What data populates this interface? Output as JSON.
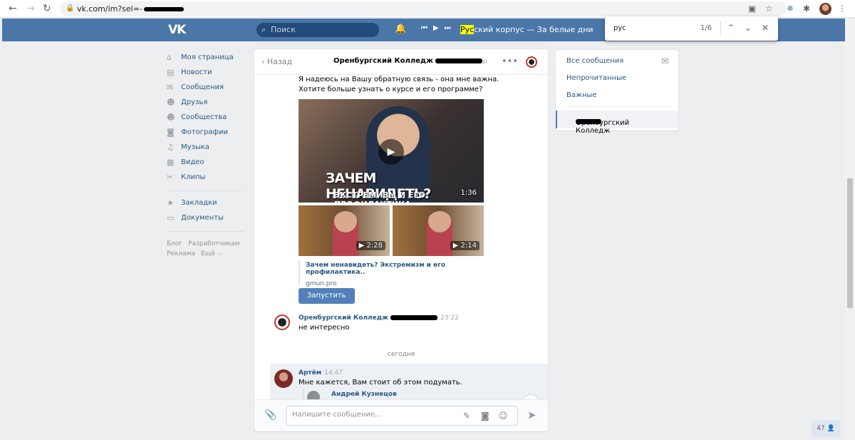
{
  "browser": {
    "url": "vk.com/im?sel=-",
    "find": {
      "query": "рус",
      "count": "1/6"
    }
  },
  "vk": {
    "search_placeholder": "Поиск",
    "now_playing": {
      "highlight": "Рус",
      "rest": "ский корпус — За белые дни"
    }
  },
  "left_menu": {
    "items": [
      {
        "label": "Моя страница",
        "icon": "home-icon"
      },
      {
        "label": "Новости",
        "icon": "news-icon"
      },
      {
        "label": "Сообщения",
        "icon": "messages-icon"
      },
      {
        "label": "Друзья",
        "icon": "friends-icon"
      },
      {
        "label": "Сообщества",
        "icon": "communities-icon"
      },
      {
        "label": "Фотографии",
        "icon": "photo-icon"
      },
      {
        "label": "Музыка",
        "icon": "music-icon"
      },
      {
        "label": "Видео",
        "icon": "video-icon"
      },
      {
        "label": "Клипы",
        "icon": "clips-icon"
      }
    ],
    "items2": [
      {
        "label": "Закладки",
        "icon": "star-icon"
      },
      {
        "label": "Документы",
        "icon": "doc-icon"
      }
    ],
    "footer": [
      "Блог",
      "Разработчикам",
      "Реклама",
      "Ещё ⌵"
    ]
  },
  "chat": {
    "back_label": "Назад",
    "title": "Оренбургский Колледж",
    "text1": "Я надеюсь на Вашу обратную связь - она мне важна.",
    "text2": "Хотите больше узнать о курсе и его программе?",
    "video_main": {
      "caption1": "ЗАЧЕМ НЕНАВИДЕТЬ?",
      "caption2": "ЭКСТРЕМИЗМ И ЕГО ПРОФИЛАКТИКА",
      "duration": "1:36"
    },
    "thumb1_duration": "▶ 2:28",
    "thumb2_duration": "▶ 2:14",
    "link_title": "Зачем ненавидеть? Экстремизм и его профилактика..",
    "link_domain": "gmun.pro",
    "run_button": "Запустить",
    "msg2": {
      "name": "Оренбургский Колледж",
      "time": "23:22",
      "text": "не интересно"
    },
    "day_separator": "сегодня",
    "msg3": {
      "name": "Артём",
      "time": "14:47",
      "text": "Мне кажется, Вам стоит об этом подумать.",
      "quote_name": "Андрей Кузнецов"
    },
    "input_placeholder": "Напишите сообщение..."
  },
  "right_menu": {
    "all": "Все сообщения",
    "unread": "Непрочитанные",
    "important": "Важные",
    "active": "Оренбургский Колледж"
  },
  "online_count": "47"
}
